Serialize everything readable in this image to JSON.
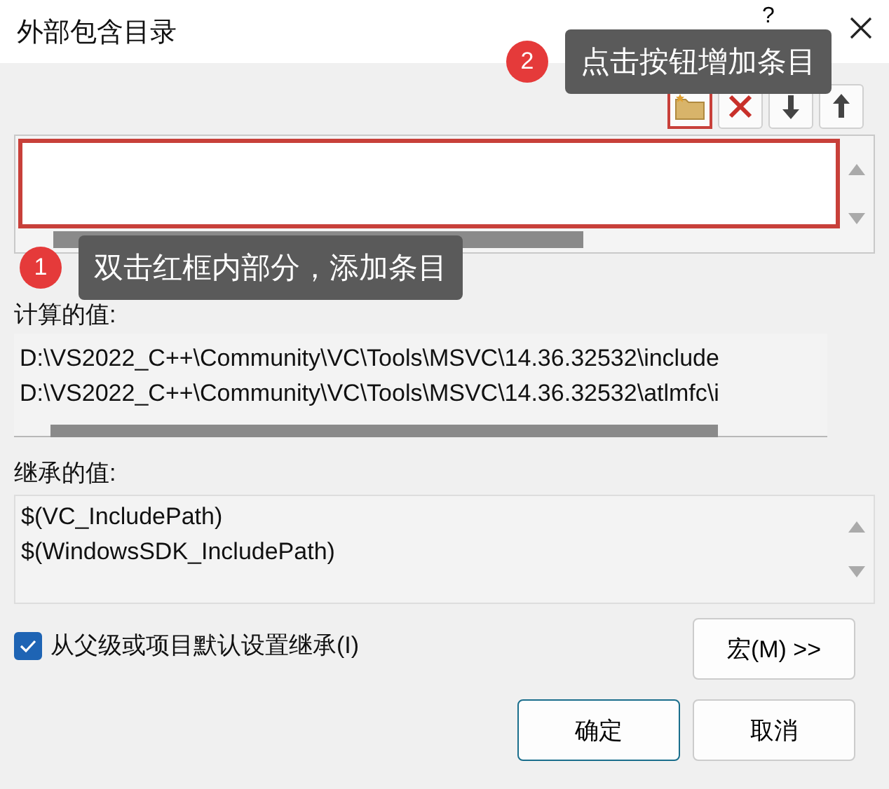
{
  "window": {
    "title": "外部包含目录",
    "help": "?"
  },
  "toolbar": [
    {
      "kind": "new",
      "highlighted": true
    },
    {
      "kind": "delete",
      "highlighted": false
    },
    {
      "kind": "down",
      "highlighted": false
    },
    {
      "kind": "up",
      "highlighted": false
    }
  ],
  "edit_list": {
    "highlighted": true
  },
  "computed": {
    "label": "计算的值:",
    "lines": [
      "D:\\VS2022_C++\\Community\\VC\\Tools\\MSVC\\14.36.32532\\include",
      "D:\\VS2022_C++\\Community\\VC\\Tools\\MSVC\\14.36.32532\\atlmfc\\i"
    ]
  },
  "inherited": {
    "label": "继承的值:",
    "lines": [
      "$(VC_IncludePath)",
      "$(WindowsSDK_IncludePath)"
    ]
  },
  "inherit_checkbox": {
    "label": "从父级或项目默认设置继承(I)",
    "checked": true
  },
  "macro_button": "宏(M) >>",
  "buttons": [
    {
      "label": "确定",
      "default": true
    },
    {
      "label": "取消",
      "default": false
    }
  ],
  "callouts": [
    {
      "number": "2",
      "text": "点击按钮增加条目"
    },
    {
      "number": "1",
      "text": "双击红框内部分，添加条目"
    }
  ]
}
